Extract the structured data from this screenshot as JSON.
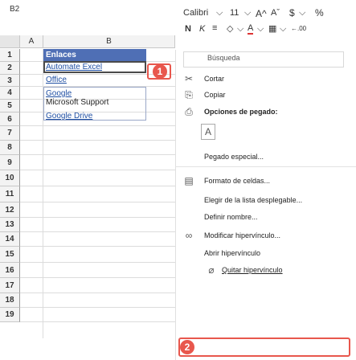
{
  "namebox": "B2",
  "columns": [
    "A",
    "B"
  ],
  "rows": [
    "1",
    "2",
    "3",
    "4",
    "5",
    "6",
    "7",
    "8",
    "9",
    "10",
    "11",
    "12",
    "13",
    "14",
    "15",
    "16",
    "17",
    "18",
    "19"
  ],
  "sheet": {
    "header": "Enlaces",
    "links": [
      "Automate Excel",
      "Office",
      "Google",
      "Microsoft Support",
      "Google Drive"
    ]
  },
  "markers": [
    "1",
    "2"
  ],
  "toolbar": {
    "font": "Calibri",
    "size": "11",
    "grow_font": "A^",
    "shrink_font": "Aˇ",
    "currency": "$",
    "percent": "%",
    "bold": "N",
    "italic": "K",
    "font_color": "A",
    "decimals": "←.00"
  },
  "menu": {
    "search": "Búsqueda",
    "cut": "Cortar",
    "copy": "Copiar",
    "paste_options": "Opciones de pegado:",
    "paste_special": "Pegado especial...",
    "format_cells": "Formato de celdas...",
    "pick_list": "Elegir de la lista desplegable...",
    "define_name": "Definir nombre...",
    "edit_hyperlink": "Modificar hipervínculo...",
    "open_hyperlink": "Abrir hipervínculo",
    "remove_hyperlink": "Quitar hipervínculo"
  },
  "colors": {
    "accent": "#e8574d",
    "header_fill": "#4f6fb5",
    "link": "#1f4fa3"
  }
}
